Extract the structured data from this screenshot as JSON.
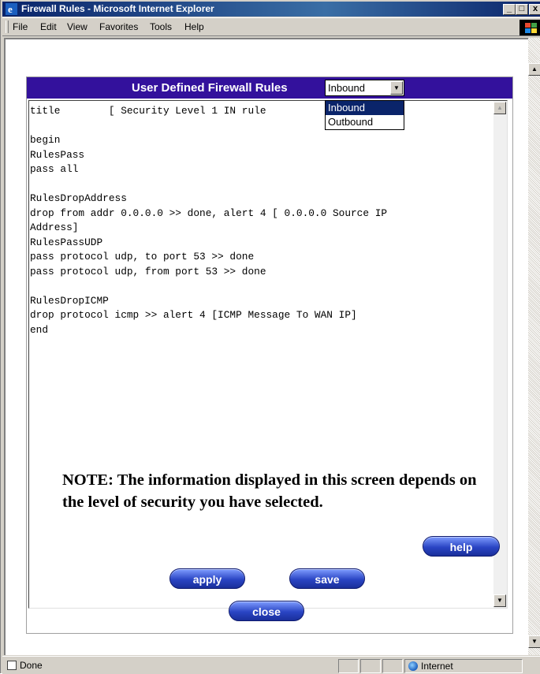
{
  "window": {
    "title": "Firewall Rules - Microsoft Internet Explorer",
    "minimize_label": "_",
    "restore_label": "□",
    "close_label": "x"
  },
  "menubar": {
    "items": [
      "File",
      "Edit",
      "View",
      "Favorites",
      "Tools",
      "Help"
    ]
  },
  "panel": {
    "title": "User Defined Firewall Rules",
    "direction_select": {
      "value": "Inbound",
      "options": [
        "Inbound",
        "Outbound"
      ],
      "highlighted": "Inbound"
    },
    "rules_text": "title        [ Security Level 1 IN rule\n\nbegin\nRulesPass\npass all\n\nRulesDropAddress\ndrop from addr 0.0.0.0 >> done, alert 4 [ 0.0.0.0 Source IP\nAddress]\nRulesPassUDP\npass protocol udp, to port 53 >> done\npass protocol udp, from port 53 >> done\n\nRulesDropICMP\ndrop protocol icmp >> alert 4 [ICMP Message To WAN IP]\nend",
    "note": "NOTE: The information displayed in this screen depends on the level of security you have selected."
  },
  "buttons": {
    "help": "help",
    "apply": "apply",
    "save": "save",
    "close": "close"
  },
  "statusbar": {
    "status": "Done",
    "zone": "Internet"
  },
  "colors": {
    "panel_header": "#33119c",
    "title_bar": "#0a246a",
    "button": "#2a45c4"
  }
}
